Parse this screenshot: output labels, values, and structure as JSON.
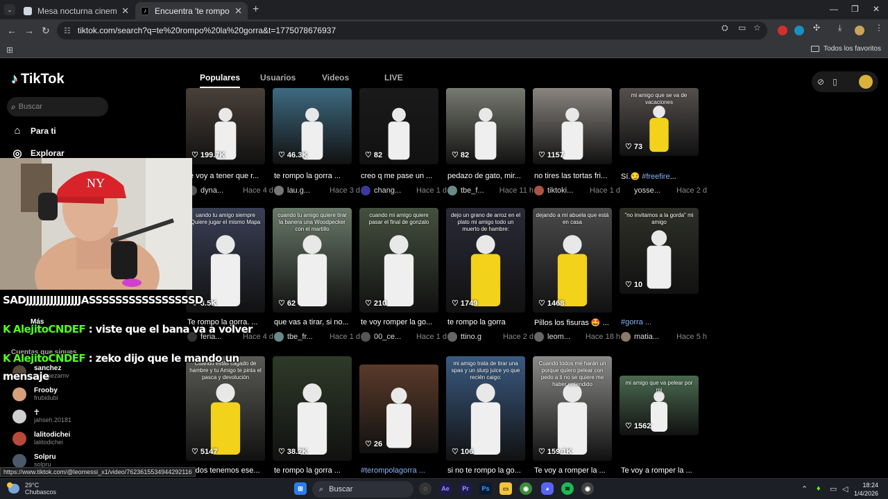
{
  "browser": {
    "tabs": [
      {
        "title": "Mesa nocturna cinematica",
        "active": false
      },
      {
        "title": "Encuentra 'te rompo la gorra' en T",
        "active": true
      }
    ],
    "url": "tiktok.com/search?q=te%20rompo%20la%20gorra&t=1775078676937",
    "bookmarks_folder": "Todos los favoritos"
  },
  "tiktok": {
    "logo": "TikTok",
    "search_placeholder": "Buscar",
    "nav": [
      {
        "label": "Para ti",
        "icon": "home-icon"
      },
      {
        "label": "Explorar",
        "icon": "compass-icon"
      },
      {
        "label": "Más",
        "icon": "more-icon"
      }
    ],
    "following_title": "Cuentas que sigues",
    "following": [
      {
        "name": "sanchez",
        "handle": "sanchezamv",
        "color": "#5a4a3a"
      },
      {
        "name": "Frooby",
        "handle": "frubidubi",
        "color": "#d7a07a"
      },
      {
        "name": "☥",
        "handle": "jahseh.20181",
        "color": "#cfcfcf"
      },
      {
        "name": "lalitodichei",
        "handle": "lalitodichei",
        "color": "#b84a3a"
      },
      {
        "name": "Solpru",
        "handle": "solpru",
        "color": "#4a5a6a"
      }
    ],
    "search_tabs": [
      "Populares",
      "Usuarios",
      "Videos",
      "LIVE"
    ],
    "active_tab": "Populares",
    "rows": [
      [
        {
          "likes": "199.7K",
          "caption": "te voy a tener que r...",
          "author": "dyna...",
          "time": "Hace 4 d",
          "bg": "#4a4038",
          "av": "#555"
        },
        {
          "likes": "46.3K",
          "caption": "te rompo la gorra ...",
          "author": "lau.g...",
          "time": "Hace 3 d",
          "bg": "#3e6a80",
          "av": "#777"
        },
        {
          "likes": "82",
          "caption": "creo q me pase un ...",
          "author": "chang...",
          "time": "Hace 1 d",
          "bg": "#1a1a1a",
          "av": "#3a3a9a"
        },
        {
          "likes": "82",
          "caption": "pedazo de gato, mir...",
          "author": "tbe_f...",
          "time": "Hace 11 h",
          "bg": "#777a70",
          "av": "#6a8a8a"
        },
        {
          "likes": "1157",
          "caption": "no tires las tortas fri...",
          "author": "tiktoki...",
          "time": "Hace 1 d",
          "bg": "#8a8580",
          "av": "#aa5544"
        },
        {
          "likes": "73",
          "caption": "Sí.😏 #freefire...",
          "author": "yosse...",
          "time": "Hace 2 d",
          "bg": "#55504e",
          "av": "#000"
        }
      ],
      [
        {
          "likes": "3.5K",
          "caption": "Te rompo la gorra. ...",
          "author": "feria...",
          "time": "Hace 4 d",
          "bg": "#3a3f55",
          "av": "#333"
        },
        {
          "likes": "62",
          "caption": "que vas a tirar, si no...",
          "author": "tbe_fr...",
          "time": "Hace 1 d",
          "bg": "#6a7a6a",
          "av": "#6a8a8a"
        },
        {
          "likes": "210",
          "caption": "te voy romper la go...",
          "author": "00_ce...",
          "time": "Hace 1 d",
          "bg": "#45503e",
          "av": "#555"
        },
        {
          "likes": "1749",
          "caption": "te rompo la gorra",
          "author": "ttino.g",
          "time": "Hace 2 d",
          "bg": "#2a2a38",
          "av": "#666"
        },
        {
          "likes": "1468",
          "caption": "Pillos los fisuras 🤩 ...",
          "author": "leom...",
          "time": "Hace 18 h",
          "bg": "#4a4a4a",
          "av": "#666"
        },
        {
          "likes": "10",
          "caption": "#gorra ...",
          "author": "matia...",
          "time": "Hace 5 h",
          "bg": "#2e3028",
          "av": "#8a7a6a"
        }
      ],
      [
        {
          "likes": "5147",
          "caption": "Todos tenemos ese...",
          "author": "",
          "time": "",
          "bg": "#5a5a55",
          "av": "#555"
        },
        {
          "likes": "38.2K",
          "caption": "te rompo la gorra ...",
          "author": "",
          "time": "",
          "bg": "#2e3a28",
          "av": "#555"
        },
        {
          "likes": "26",
          "caption": "#terompolagorra ...",
          "author": "",
          "time": "",
          "bg": "#5a3a2a",
          "av": "#555"
        },
        {
          "likes": "106",
          "caption": "si no te rompo la go...",
          "author": "",
          "time": "",
          "bg": "#3a5a80",
          "av": "#555"
        },
        {
          "likes": "159.1K",
          "caption": "Te voy a romper la ...",
          "author": "",
          "time": "",
          "bg": "#8a8a88",
          "av": "#555"
        },
        {
          "likes": "1562",
          "caption": "Te voy a romper la ...",
          "author": "",
          "time": "",
          "bg": "#4a6a50",
          "av": "#555"
        }
      ]
    ],
    "overlay_texts": {
      "r2c1": "uando tu amigo siempre Quiere jugar el mismo Mapa",
      "r2c2": "cuando tu amigo quiere tirar la banera una Woodpecker con el martillo",
      "r2c3": "cuando mi amigo quiere pasar el final de gonzalo",
      "r2c4": "dejo un grano de arroz en el plato mi amigo todo un muerto de hambre:",
      "r2c5": "dejando a mi abuela que está en casa",
      "r2c6": "\"no invitamos a la gorda\" mi amigo",
      "r3c1": "Cuando estás cagado de hambre y tu Amigo te pinta el pasca y devolución",
      "r3c4": "mi amigo trata de tirar una spas y un slurp juice yo que recién caigo:",
      "r3c5": "Cuando todos me harán un porque quiero pelear con pedo a ti no se quiere me haber entendido",
      "r3c6": "mi amigo que va pelear por mi",
      "r1c6": "mi amigo que se va de vacaciones"
    }
  },
  "stream_chat": [
    {
      "user": "",
      "text": "SADJJJJJJJJJJJJJJJJASSSSSSSSSSSSSSSSD"
    },
    {
      "user": "AlejitoCNDEF",
      "text": ": viste que el bana va a volver"
    },
    {
      "user": "AlejitoCNDEF",
      "text": ": zeko dijo que le mando un"
    },
    {
      "user": "",
      "text": "mensaje"
    }
  ],
  "status_url": "https://www.tiktok.com/@leomessi_x1/video/7623615534944292116",
  "taskbar": {
    "temperature": "29°C",
    "weather": "Chubascos",
    "search": "Buscar",
    "time": "18:24",
    "date": "1/4/2026"
  },
  "colors": {
    "tiktok_cyan": "#25f4ee",
    "tiktok_red": "#fe2c55",
    "kick_green": "#53fc18"
  }
}
